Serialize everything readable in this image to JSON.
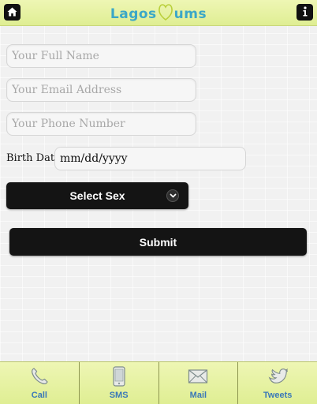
{
  "header": {
    "logo_left": "Lagos",
    "logo_right": "ums",
    "home_icon": "home-icon",
    "info_icon": "info-icon"
  },
  "form": {
    "full_name_placeholder": "Your Full Name",
    "email_placeholder": "Your Email Address",
    "phone_placeholder": "Your Phone Number",
    "birth_date_label": "Birth Date",
    "birth_date_value": "mm/dd/yyyy",
    "sex_select_label": "Select Sex",
    "submit_label": "Submit"
  },
  "tabs": [
    {
      "label": "Call",
      "icon": "phone-icon"
    },
    {
      "label": "SMS",
      "icon": "mobile-icon"
    },
    {
      "label": "Mail",
      "icon": "mail-icon"
    },
    {
      "label": "Tweets",
      "icon": "bird-icon"
    }
  ],
  "colors": {
    "header_bg": "#e5f1a0",
    "logo_blue": "#3ba7c7",
    "logo_heart": "#b9cf3a",
    "button_bg": "#141414",
    "tab_label": "#3a78b8"
  }
}
